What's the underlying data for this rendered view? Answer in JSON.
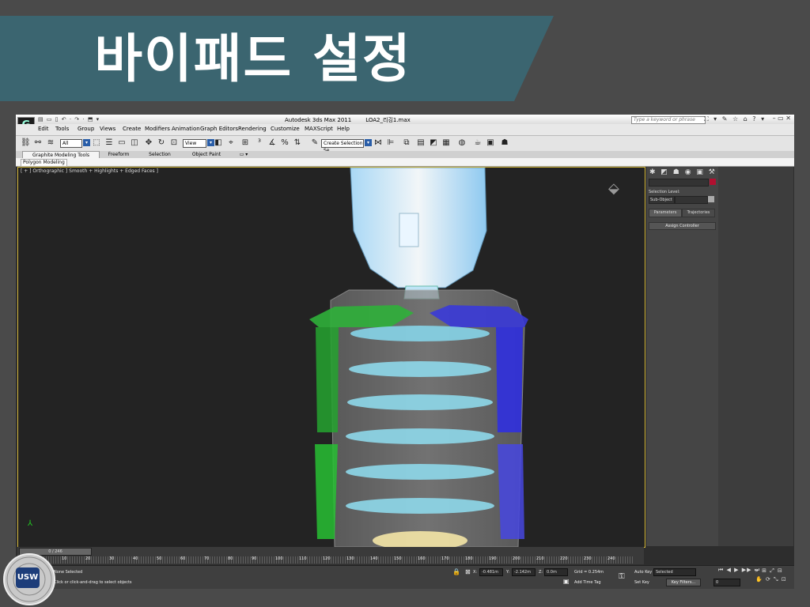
{
  "slide": {
    "title": "바이패드 설정"
  },
  "app": {
    "name": "Autodesk 3ds Max  2011",
    "file": "LOA2_리깅1.max",
    "logo": "G",
    "quick_access": "▤ ▭ ▯ ↶ · ↷ · ⬒ ▾",
    "search_placeholder": "Type a keyword or phrase",
    "title_icons": "⛶ ▾ ✎ ☆ ⌂  ? ▾",
    "window_controls": "– ▭ ✕"
  },
  "menu": [
    "Edit",
    "Tools",
    "Group",
    "Views",
    "Create",
    "Modifiers",
    "Animation",
    "Graph Editors",
    "Rendering",
    "Customize",
    "MAXScript",
    "Help"
  ],
  "toolbar": {
    "filter": "All",
    "ref_coord": "View",
    "named_selection": "Create Selection Se"
  },
  "ribbon": {
    "tabs": [
      "Graphite Modeling Tools",
      "Freeform",
      "Selection",
      "Object Paint",
      "▭ ▾"
    ],
    "panel": "Polygon Modeling"
  },
  "viewport": {
    "label": "[ + ] Orthographic ] Smooth + Highlights + Edged Faces ]"
  },
  "command_panel": {
    "icons": "✱ ◩ ☗ ◉ ▣ ⚒",
    "selection_level_label": "Selection Level:",
    "sub_object": "Sub-Object",
    "tabs": [
      "Parameters",
      "Trajectories"
    ],
    "rollout": "Assign Controller"
  },
  "timeline": {
    "slider": "0 / 246",
    "ticks": [
      10,
      20,
      30,
      40,
      50,
      60,
      70,
      80,
      90,
      100,
      110,
      120,
      130,
      140,
      150,
      160,
      170,
      180,
      190,
      200,
      210,
      220,
      230,
      240
    ]
  },
  "status": {
    "selection": "None Selected",
    "prompt": "Click or click-and-drag to select objects",
    "x_label": "X:",
    "x_value": "-0.481m",
    "y_label": "Y:",
    "y_value": "-2.142m",
    "z_label": "Z:",
    "z_value": "0.0m",
    "grid": "Grid = 0.254m",
    "add_time_tag": "Add Time Tag",
    "auto_key": "Auto Key",
    "auto_key_mode": "Selected",
    "set_key": "Set Key",
    "key_filters": "Key Filters...",
    "frame": "0"
  },
  "logo": {
    "text": "USW",
    "ring_text": "THE UNIVERSITY OF SUWON"
  }
}
